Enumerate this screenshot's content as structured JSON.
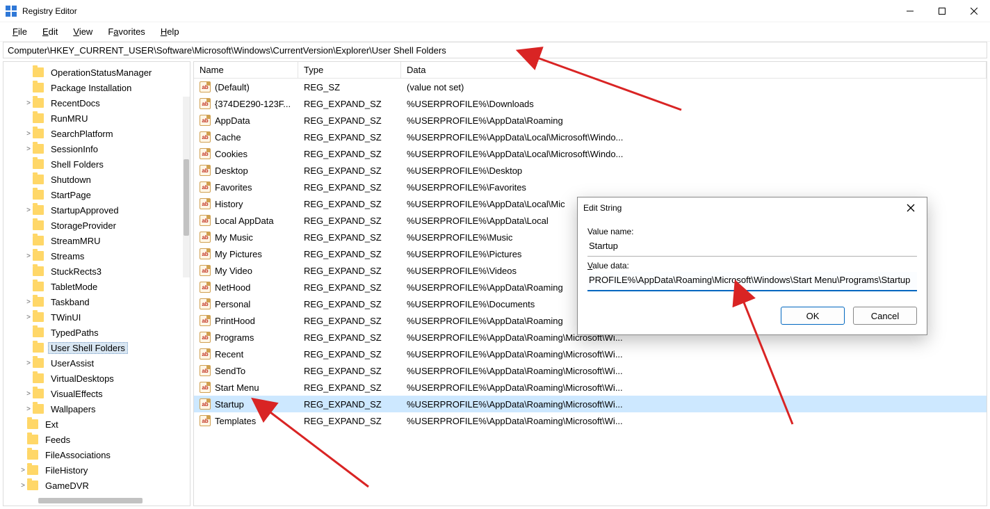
{
  "window_title": "Registry Editor",
  "menu": {
    "file": "File",
    "edit": "Edit",
    "view": "View",
    "favorites": "Favorites",
    "help": "Help"
  },
  "address": "Computer\\HKEY_CURRENT_USER\\Software\\Microsoft\\Windows\\CurrentVersion\\Explorer\\User Shell Folders",
  "tree": [
    {
      "label": "OperationStatusManager",
      "depth": 3,
      "expand": ""
    },
    {
      "label": "Package Installation",
      "depth": 3,
      "expand": ""
    },
    {
      "label": "RecentDocs",
      "depth": 3,
      "expand": ">"
    },
    {
      "label": "RunMRU",
      "depth": 3,
      "expand": ""
    },
    {
      "label": "SearchPlatform",
      "depth": 3,
      "expand": ">"
    },
    {
      "label": "SessionInfo",
      "depth": 3,
      "expand": ">"
    },
    {
      "label": "Shell Folders",
      "depth": 3,
      "expand": ""
    },
    {
      "label": "Shutdown",
      "depth": 3,
      "expand": ""
    },
    {
      "label": "StartPage",
      "depth": 3,
      "expand": ""
    },
    {
      "label": "StartupApproved",
      "depth": 3,
      "expand": ">"
    },
    {
      "label": "StorageProvider",
      "depth": 3,
      "expand": ""
    },
    {
      "label": "StreamMRU",
      "depth": 3,
      "expand": ""
    },
    {
      "label": "Streams",
      "depth": 3,
      "expand": ">"
    },
    {
      "label": "StuckRects3",
      "depth": 3,
      "expand": ""
    },
    {
      "label": "TabletMode",
      "depth": 3,
      "expand": ""
    },
    {
      "label": "Taskband",
      "depth": 3,
      "expand": ">"
    },
    {
      "label": "TWinUI",
      "depth": 3,
      "expand": ">"
    },
    {
      "label": "TypedPaths",
      "depth": 3,
      "expand": ""
    },
    {
      "label": "User Shell Folders",
      "depth": 3,
      "expand": "",
      "selected": true
    },
    {
      "label": "UserAssist",
      "depth": 3,
      "expand": ">"
    },
    {
      "label": "VirtualDesktops",
      "depth": 3,
      "expand": ""
    },
    {
      "label": "VisualEffects",
      "depth": 3,
      "expand": ">"
    },
    {
      "label": "Wallpapers",
      "depth": 3,
      "expand": ">"
    },
    {
      "label": "Ext",
      "depth": 2,
      "expand": ""
    },
    {
      "label": "Feeds",
      "depth": 2,
      "expand": ""
    },
    {
      "label": "FileAssociations",
      "depth": 2,
      "expand": ""
    },
    {
      "label": "FileHistory",
      "depth": 2,
      "expand": ">"
    },
    {
      "label": "GameDVR",
      "depth": 2,
      "expand": ">"
    }
  ],
  "columns": {
    "name": "Name",
    "type": "Type",
    "data": "Data"
  },
  "values": [
    {
      "name": "(Default)",
      "type": "REG_SZ",
      "data": "(value not set)"
    },
    {
      "name": "{374DE290-123F...",
      "type": "REG_EXPAND_SZ",
      "data": "%USERPROFILE%\\Downloads"
    },
    {
      "name": "AppData",
      "type": "REG_EXPAND_SZ",
      "data": "%USERPROFILE%\\AppData\\Roaming"
    },
    {
      "name": "Cache",
      "type": "REG_EXPAND_SZ",
      "data": "%USERPROFILE%\\AppData\\Local\\Microsoft\\Windo..."
    },
    {
      "name": "Cookies",
      "type": "REG_EXPAND_SZ",
      "data": "%USERPROFILE%\\AppData\\Local\\Microsoft\\Windo..."
    },
    {
      "name": "Desktop",
      "type": "REG_EXPAND_SZ",
      "data": "%USERPROFILE%\\Desktop"
    },
    {
      "name": "Favorites",
      "type": "REG_EXPAND_SZ",
      "data": "%USERPROFILE%\\Favorites"
    },
    {
      "name": "History",
      "type": "REG_EXPAND_SZ",
      "data": "%USERPROFILE%\\AppData\\Local\\Mic"
    },
    {
      "name": "Local AppData",
      "type": "REG_EXPAND_SZ",
      "data": "%USERPROFILE%\\AppData\\Local"
    },
    {
      "name": "My Music",
      "type": "REG_EXPAND_SZ",
      "data": "%USERPROFILE%\\Music"
    },
    {
      "name": "My Pictures",
      "type": "REG_EXPAND_SZ",
      "data": "%USERPROFILE%\\Pictures"
    },
    {
      "name": "My Video",
      "type": "REG_EXPAND_SZ",
      "data": "%USERPROFILE%\\Videos"
    },
    {
      "name": "NetHood",
      "type": "REG_EXPAND_SZ",
      "data": "%USERPROFILE%\\AppData\\Roaming"
    },
    {
      "name": "Personal",
      "type": "REG_EXPAND_SZ",
      "data": "%USERPROFILE%\\Documents"
    },
    {
      "name": "PrintHood",
      "type": "REG_EXPAND_SZ",
      "data": "%USERPROFILE%\\AppData\\Roaming"
    },
    {
      "name": "Programs",
      "type": "REG_EXPAND_SZ",
      "data": "%USERPROFILE%\\AppData\\Roaming\\Microsoft\\Wi..."
    },
    {
      "name": "Recent",
      "type": "REG_EXPAND_SZ",
      "data": "%USERPROFILE%\\AppData\\Roaming\\Microsoft\\Wi..."
    },
    {
      "name": "SendTo",
      "type": "REG_EXPAND_SZ",
      "data": "%USERPROFILE%\\AppData\\Roaming\\Microsoft\\Wi..."
    },
    {
      "name": "Start Menu",
      "type": "REG_EXPAND_SZ",
      "data": "%USERPROFILE%\\AppData\\Roaming\\Microsoft\\Wi..."
    },
    {
      "name": "Startup",
      "type": "REG_EXPAND_SZ",
      "data": "%USERPROFILE%\\AppData\\Roaming\\Microsoft\\Wi...",
      "selected": true
    },
    {
      "name": "Templates",
      "type": "REG_EXPAND_SZ",
      "data": "%USERPROFILE%\\AppData\\Roaming\\Microsoft\\Wi..."
    }
  ],
  "dialog": {
    "title": "Edit String",
    "value_name_label": "Value name:",
    "value_name": "Startup",
    "value_data_label": "Value data:",
    "value_data": "PROFILE%\\AppData\\Roaming\\Microsoft\\Windows\\Start Menu\\Programs\\Startup",
    "ok": "OK",
    "cancel": "Cancel"
  }
}
